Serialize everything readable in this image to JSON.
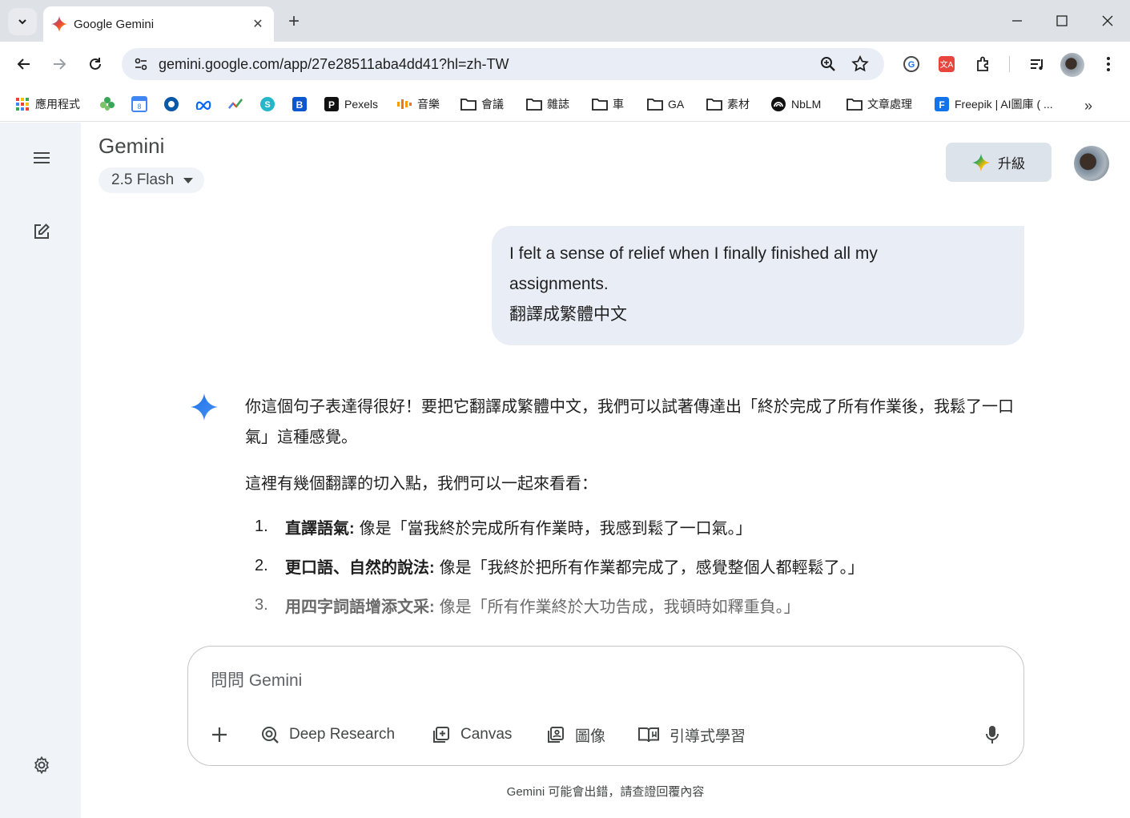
{
  "browser": {
    "tab_title": "Google Gemini",
    "url": "gemini.google.com/app/27e28511aba4dd41?hl=zh-TW",
    "bookmarks": [
      {
        "label": "應用程式",
        "icon": "apps-grid-icon"
      },
      {
        "label": "",
        "icon": "green-leaf-icon"
      },
      {
        "label": "",
        "icon": "calendar-icon"
      },
      {
        "label": "",
        "icon": "blue-circle-icon"
      },
      {
        "label": "",
        "icon": "meta-icon"
      },
      {
        "label": "",
        "icon": "trend-icon"
      },
      {
        "label": "",
        "icon": "teal-s-icon"
      },
      {
        "label": "",
        "icon": "blue-b-icon"
      },
      {
        "label": "Pexels",
        "icon": "pexels-icon"
      },
      {
        "label": "音樂",
        "icon": "music-wave-icon"
      },
      {
        "label": "會議",
        "icon": "folder-icon"
      },
      {
        "label": "雜誌",
        "icon": "folder-icon"
      },
      {
        "label": "車",
        "icon": "folder-icon"
      },
      {
        "label": "GA",
        "icon": "folder-icon"
      },
      {
        "label": "素材",
        "icon": "folder-icon"
      },
      {
        "label": "NbLM",
        "icon": "notebooklm-icon"
      },
      {
        "label": "文章處理",
        "icon": "folder-icon"
      },
      {
        "label": "Freepik | AI圖庫 ( ...",
        "icon": "freepik-icon"
      }
    ]
  },
  "app": {
    "title": "Gemini",
    "model": "2.5 Flash",
    "upgrade_label": "升級"
  },
  "conversation": {
    "user_line1": "I felt a sense of relief when I finally finished all my",
    "user_line2": "assignments.",
    "user_line3": "翻譯成繁體中文",
    "reply_p1": "你這個句子表達得很好！要把它翻譯成繁體中文，我們可以試著傳達出「終於完成了所有作業後，我鬆了一口氣」這種感覺。",
    "reply_p2": "這裡有幾個翻譯的切入點，我們可以一起來看看：",
    "items": [
      {
        "num": "1.",
        "head": "直譯語氣:",
        "text": "像是「當我終於完成所有作業時，我感到鬆了一口氣。」"
      },
      {
        "num": "2.",
        "head": "更口語、自然的說法:",
        "text": "像是「我終於把所有作業都完成了，感覺整個人都輕鬆了。」"
      },
      {
        "num": "3.",
        "head": "用四字詞語增添文采:",
        "text": "像是「所有作業終於大功告成，我頓時如釋重負。」"
      }
    ]
  },
  "composer": {
    "placeholder": "問問 Gemini",
    "tools": {
      "deep_research": "Deep Research",
      "canvas": "Canvas",
      "image": "圖像",
      "guided": "引導式學習"
    }
  },
  "disclaimer": "Gemini 可能會出錯，請查證回覆內容"
}
